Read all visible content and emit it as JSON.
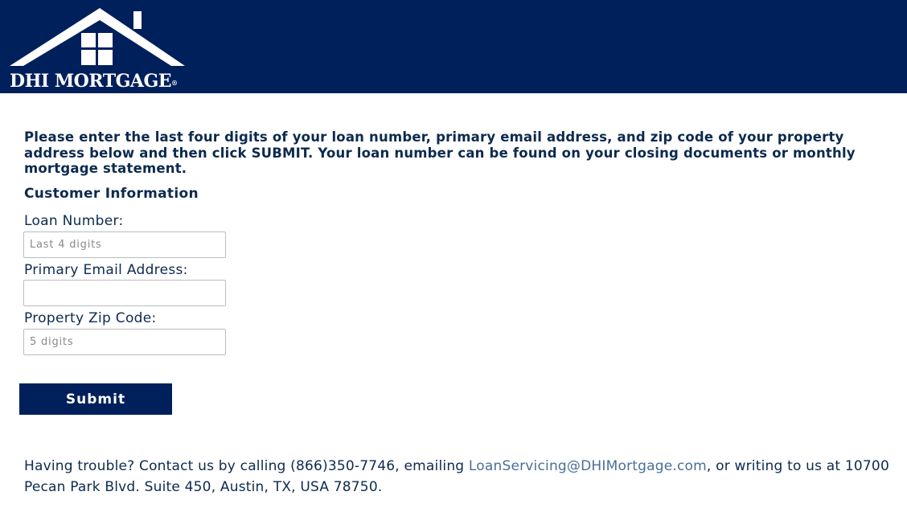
{
  "header": {
    "logo_text": "DHI MORTGAGE",
    "logo_mark": "®",
    "background_color": "#00205b"
  },
  "intro": {
    "text": "Please enter the last four digits of your loan number, primary email address, and zip code of your property address below and then click SUBMIT. Your loan number can be found on your closing documents or monthly mortgage statement."
  },
  "form": {
    "section_title": "Customer Information",
    "loan_number": {
      "label": "Loan Number:",
      "placeholder": "Last 4 digits",
      "value": ""
    },
    "email": {
      "label": "Primary Email Address:",
      "placeholder": "",
      "value": ""
    },
    "zip": {
      "label": "Property Zip Code:",
      "placeholder": "5 digits",
      "value": ""
    },
    "submit_label": "Submit"
  },
  "footer": {
    "text_before": "Having trouble? Contact us by calling (866)350-7746, emailing ",
    "email_link": "LoanServicing@DHIMortgage.com",
    "text_after": ", or writing to us at 10700 Pecan Park Blvd. Suite 450, Austin, TX, USA 78750.",
    "link_color": "#4a6f96"
  }
}
